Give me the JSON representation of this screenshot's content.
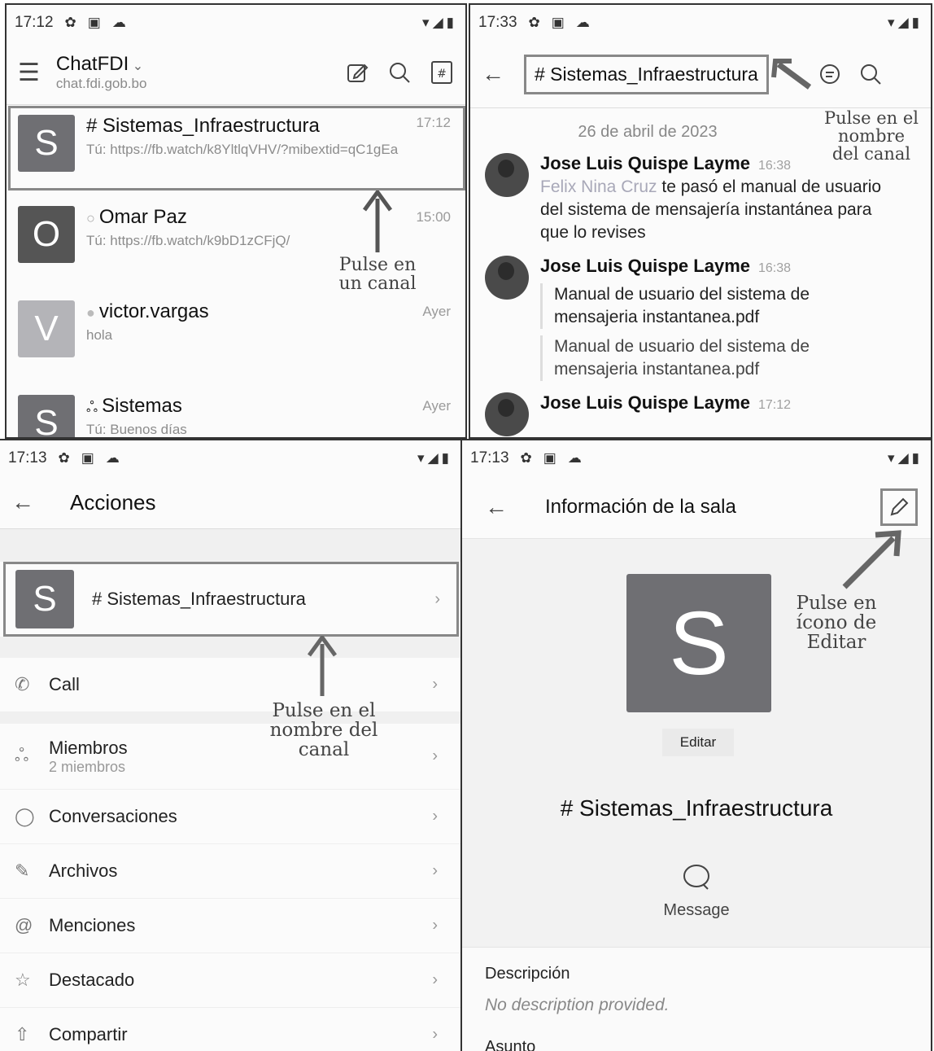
{
  "panel1": {
    "status": {
      "time": "17:12",
      "icons": "▾◢▮"
    },
    "workspace": "ChatFDI",
    "server": "chat.fdi.gob.bo",
    "rooms": [
      {
        "avatar": "S",
        "name": "# Sistemas_Infraestructura",
        "time": "17:12",
        "msg": "Tú: https://fb.watch/k8YltlqVHV/?mibextid=qC1gEa"
      },
      {
        "avatar": "O",
        "name": "Omar Paz",
        "time": "15:00",
        "msg": "Tú: https://fb.watch/k9bD1zCFjQ/"
      },
      {
        "avatar": "V",
        "name": "victor.vargas",
        "time": "Ayer",
        "msg": "hola"
      },
      {
        "avatar": "S",
        "name": "Sistemas",
        "time": "Ayer",
        "msg": "Tú: Buenos días"
      }
    ],
    "annotation": "Pulse en un canal"
  },
  "panel2": {
    "status": {
      "time": "17:33",
      "icons": "▾◢▮"
    },
    "channel": "# Sistemas_Infraestructura",
    "date": "26 de abril de 2023",
    "annotation": "Pulse en el nombre del canal",
    "messages": [
      {
        "author": "Jose Luis Quispe Layme",
        "time": "16:38",
        "mention": "Felix Nina Cruz",
        "text": " te pasó el manual de usuario del sistema de mensajería instantánea para que lo revises"
      },
      {
        "author": "Jose Luis Quispe Layme",
        "time": "16:38",
        "file1": "Manual de usuario del sistema de mensajeria instantanea.pdf",
        "file2": "Manual de usuario del sistema de mensajeria instantanea.pdf"
      },
      {
        "author": "Jose Luis Quispe Layme",
        "time": "17:12"
      }
    ]
  },
  "panel3": {
    "status": {
      "time": "17:13",
      "icons": "▾◢▮"
    },
    "title": "Acciones",
    "room": {
      "avatar": "S",
      "name": "# Sistemas_Infraestructura"
    },
    "annotation": "Pulse en el nombre del canal",
    "items": [
      {
        "label": "Call",
        "icon": "phone-icon"
      },
      {
        "label": "Miembros",
        "sub": "2 miembros",
        "icon": "members-icon"
      },
      {
        "label": "Conversaciones",
        "icon": "chat-icon"
      },
      {
        "label": "Archivos",
        "icon": "paperclip-icon"
      },
      {
        "label": "Menciones",
        "icon": "at-icon"
      },
      {
        "label": "Destacado",
        "icon": "star-icon"
      },
      {
        "label": "Compartir",
        "icon": "share-icon"
      }
    ]
  },
  "panel4": {
    "status": {
      "time": "17:13",
      "icons": "▾◢▮"
    },
    "title": "Información de la sala",
    "avatar": "S",
    "edit_label": "Editar",
    "room_name": "# Sistemas_Infraestructura",
    "message_label": "Message",
    "description_label": "Descripción",
    "description_value": "No description provided.",
    "topic_label": "Asunto",
    "annotation": "Pulse en ícono de Editar"
  }
}
